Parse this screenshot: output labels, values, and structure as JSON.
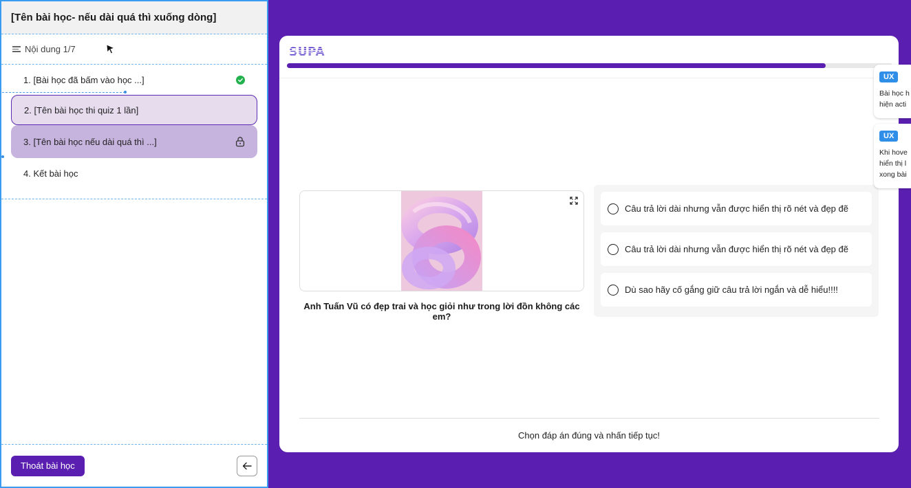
{
  "sidebar": {
    "title": "[Tên bài học- nếu dài quá thì xuống dòng]",
    "content_progress": "Nội dung 1/7",
    "lessons": [
      {
        "label": "1. [Bài học đã bấm vào học ...]",
        "status": "completed",
        "icon": "check-icon"
      },
      {
        "label": "2. [Tên bài học thi quiz 1 lần]",
        "status": "active",
        "icon": ""
      },
      {
        "label": "3. [Tên bài học nếu dài quá thì ...]",
        "status": "locked",
        "icon": "lock-icon"
      },
      {
        "label": "4. Kết bài học",
        "status": "normal",
        "icon": ""
      }
    ],
    "exit_label": "Thoát bài học",
    "back_icon": "arrow-left-icon"
  },
  "card": {
    "logo": "SUPA",
    "progress": 0.89,
    "question": "Anh Tuấn Vũ có đẹp trai và học giỏi như trong lời đồn không các em?",
    "answers": [
      "Câu trả lời dài nhưng vẫn được hiển thị rõ nét và đẹp đẽ",
      "Câu trả lời dài nhưng vẫn được hiển thị rõ nét và đẹp đẽ",
      "Dù sao hãy cố gắng giữ câu trả lời ngắn và dễ hiểu!!!!"
    ],
    "footer_hint": "Chọn đáp án đúng và nhấn tiếp tục!"
  },
  "ux_notes": [
    {
      "badge": "UX",
      "lines": [
        "Bài học h",
        "hiện acti"
      ]
    },
    {
      "badge": "UX",
      "lines": [
        "Khi hove",
        "hiển thị l",
        "xong bài"
      ]
    }
  ],
  "colors": {
    "brand_purple": "#5a1fb0",
    "selection_blue": "#3b9bf0",
    "success_green": "#22b14c",
    "active_lesson_bg": "#e6dcee",
    "locked_lesson_bg": "#c7b4de",
    "ux_badge": "#2f8fe8"
  }
}
